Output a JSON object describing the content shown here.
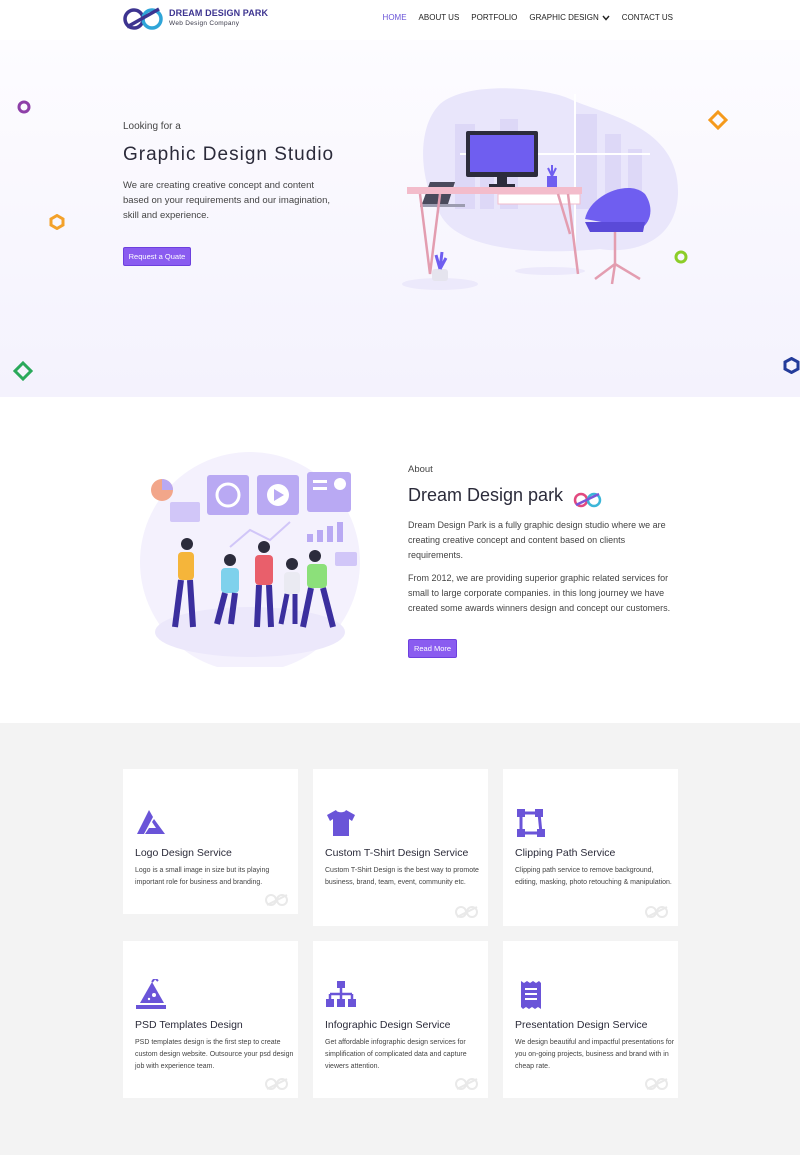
{
  "brand": {
    "name": "DREAM DESIGN PARK",
    "tagline": "Web Design Company",
    "accent": "#8a5cf0",
    "accent_dark": "#6d40de"
  },
  "nav": {
    "items": [
      {
        "label": "HOME",
        "active": true
      },
      {
        "label": "ABOUT US"
      },
      {
        "label": "PORTFOLIO"
      },
      {
        "label": "GRAPHIC DESIGN",
        "has_dropdown": true
      },
      {
        "label": "CONTACT US"
      }
    ]
  },
  "hero": {
    "eyebrow": "Looking for a",
    "title": "Graphic Design Studio",
    "description": "We are creating creative concept and content based on your requirements and our imagination, skill and experience.",
    "button_label": "Request a Quate"
  },
  "about": {
    "eyebrow": "About",
    "title": "Dream Design park",
    "paragraph1": "Dream Design Park is a fully graphic design studio where we are creating creative concept and content based on clients requirements.",
    "paragraph2": "From 2012, we are providing superior graphic related services for small to large corporate companies. in this long journey we have created some awards winners design and concept our customers.",
    "button_label": "Read More"
  },
  "services": [
    {
      "icon": "triangle-logo-icon",
      "title": "Logo Design Service",
      "description": "Logo is a small image in size but its playing important role for business and branding."
    },
    {
      "icon": "tshirt-icon",
      "title": "Custom T-Shirt Design Service",
      "description": "Custom T-Shirt Design is the best way to promote business, brand, team, event, community etc."
    },
    {
      "icon": "clipping-path-icon",
      "title": "Clipping Path Service",
      "description": "Clipping path service to remove background, editing, masking, photo retouching & manipulation."
    },
    {
      "icon": "psd-wizard-hat-icon",
      "title": "PSD Templates Design",
      "description": "PSD templates design is the first step to create custom design website. Outsource your psd design job with experience team."
    },
    {
      "icon": "sitemap-icon",
      "title": "Infographic Design Service",
      "description": "Get affordable infographic design services for simplification of complicated data and capture viewers attention."
    },
    {
      "icon": "receipt-document-icon",
      "title": "Presentation Design Service",
      "description": "We design beautiful and impactful presentations for you on-going projects, business and brand with in cheap rate."
    }
  ]
}
